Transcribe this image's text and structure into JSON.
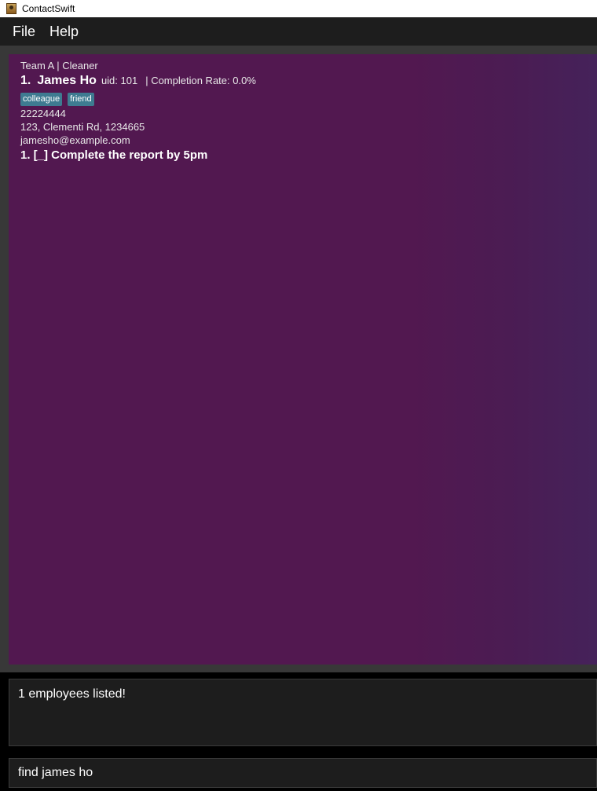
{
  "window": {
    "title": "ContactSwift",
    "icon": "contact-book-icon"
  },
  "menu": {
    "file": "File",
    "help": "Help"
  },
  "employees": [
    {
      "team_role": "Team A | Cleaner",
      "index": "1.",
      "name": "James Ho",
      "uid": "uid: 101",
      "completion": "| Completion Rate: 0.0%",
      "tags": [
        "colleague",
        "friend"
      ],
      "phone": "22224444",
      "address": "123, Clementi Rd, 1234665",
      "email": "jamesho@example.com",
      "tasks": [
        "1. [_] Complete the report by 5pm"
      ]
    }
  ],
  "result": {
    "message": "1 employees listed!"
  },
  "command": {
    "value": "find james ho"
  },
  "colors": {
    "card_background": "#521850",
    "tag_background": "#3e7b91",
    "panel_background": "#1d1d1d"
  }
}
